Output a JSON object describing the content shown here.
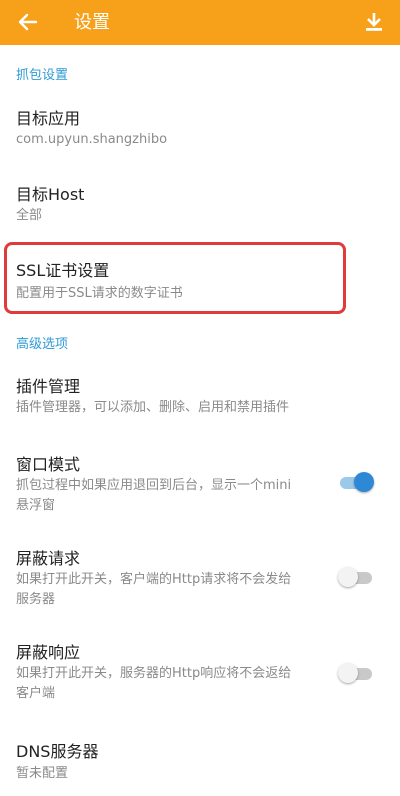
{
  "colors": {
    "appbar": "#f7a11a",
    "accent": "#2e9bd6",
    "highlight": "#e03b3b"
  },
  "appbar": {
    "title": "设置",
    "back_icon": "back-arrow-icon",
    "download_icon": "download-icon"
  },
  "sections": [
    {
      "header": "抓包设置"
    },
    {
      "header": "高级选项"
    }
  ],
  "items": {
    "target_app": {
      "title": "目标应用",
      "subtitle": "com.upyun.shangzhibo"
    },
    "target_host": {
      "title": "目标Host",
      "subtitle": "全部"
    },
    "ssl_cert": {
      "title": "SSL证书设置",
      "subtitle": "配置用于SSL请求的数字证书"
    },
    "plugin_mgmt": {
      "title": "插件管理",
      "subtitle": "插件管理器，可以添加、删除、启用和禁用插件"
    },
    "window_mode": {
      "title": "窗口模式",
      "subtitle_line1": "抓包过程中如果应用退回到后台，显示一个mini",
      "subtitle_line2": "悬浮窗",
      "enabled": true
    },
    "block_request": {
      "title": "屏蔽请求",
      "subtitle_line1": "如果打开此开关，客户端的Http请求将不会发给",
      "subtitle_line2": "服务器",
      "enabled": false
    },
    "block_response": {
      "title": "屏蔽响应",
      "subtitle_line1": "如果打开此开关，服务器的Http响应将不会返给",
      "subtitle_line2": "客户端",
      "enabled": false
    },
    "dns_server": {
      "title": "DNS服务器",
      "subtitle": "暂未配置"
    }
  }
}
